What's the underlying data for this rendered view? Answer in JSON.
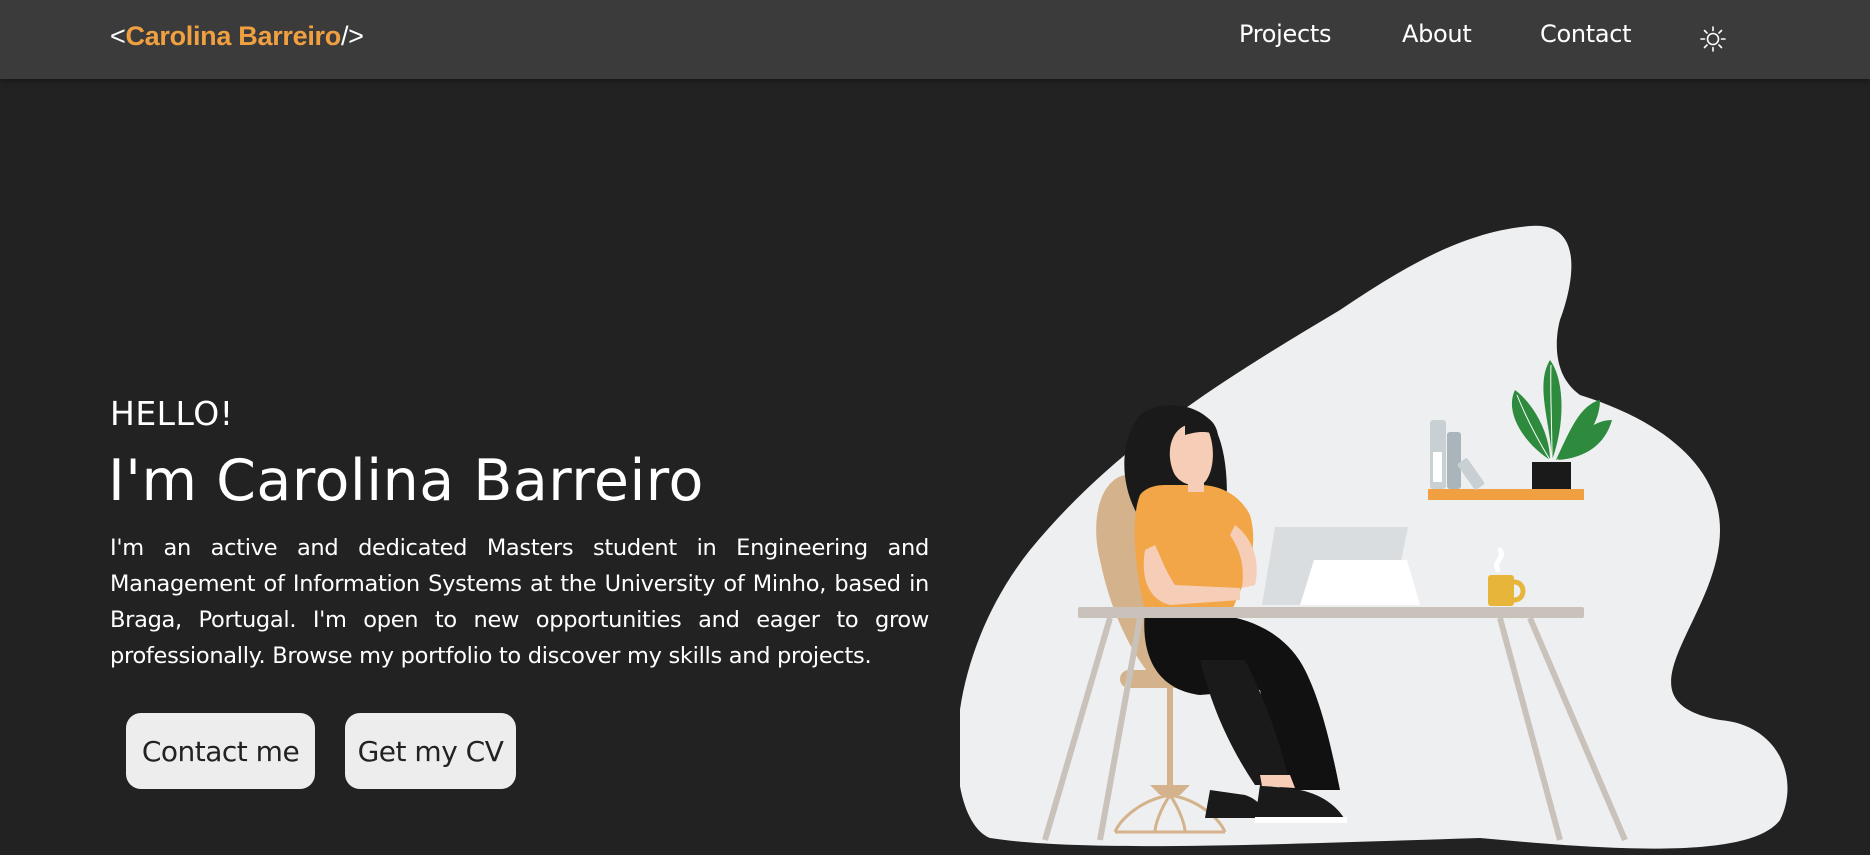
{
  "header": {
    "logo": {
      "open": "<",
      "name": "Carolina Barreiro",
      "close": "/>"
    },
    "nav": [
      {
        "label": "Projects"
      },
      {
        "label": "About"
      },
      {
        "label": "Contact"
      }
    ],
    "theme_toggle_icon": "sun-icon"
  },
  "hero": {
    "greeting": "HELLO!",
    "title": "I'm Carolina Barreiro",
    "description": "I'm an active and dedicated Masters student in Engineering and Management of Information Systems at the University of Minho, based in Braga, Portugal. I'm open to new opportunities and eager to grow professionally. Browse my portfolio to discover my skills and projects.",
    "buttons": {
      "contact": "Contact me",
      "cv": "Get my CV"
    }
  },
  "colors": {
    "background": "#222222",
    "navbar": "#3b3b3b",
    "accent": "#f0a040",
    "button_bg": "#ededed",
    "blob": "#eeeff0"
  }
}
